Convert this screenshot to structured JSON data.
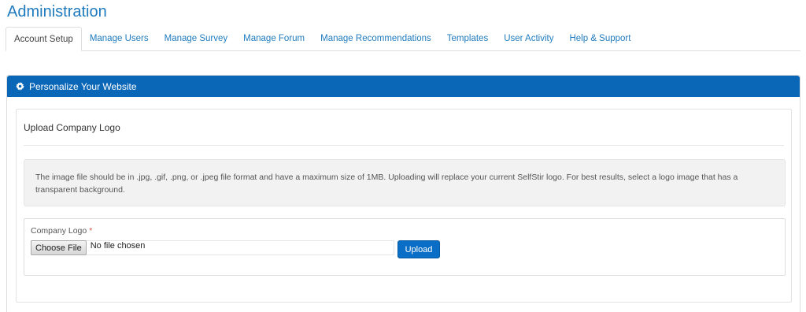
{
  "page": {
    "title": "Administration"
  },
  "tabs": [
    {
      "label": "Account Setup",
      "active": true
    },
    {
      "label": "Manage Users",
      "active": false
    },
    {
      "label": "Manage Survey",
      "active": false
    },
    {
      "label": "Manage Forum",
      "active": false
    },
    {
      "label": "Manage Recommendations",
      "active": false
    },
    {
      "label": "Templates",
      "active": false
    },
    {
      "label": "User Activity",
      "active": false
    },
    {
      "label": "Help & Support",
      "active": false
    }
  ],
  "panel": {
    "title": "Personalize Your Website",
    "icon": "gear-icon",
    "header_color": "#0a66b7"
  },
  "logo_section": {
    "title": "Upload Company Logo",
    "note": "The image file should be in .jpg, .gif, .png, or .jpeg file format and have a maximum size of 1MB. Uploading will replace your current SelfStir logo. For best results, select a logo image that has a transparent background.",
    "field_label": "Company Logo",
    "required_marker": "*",
    "choose_file_label": "Choose File",
    "file_status": "No file chosen",
    "upload_label": "Upload"
  },
  "colors": {
    "link": "#1f7bbd",
    "accent": "#0b6ec6",
    "required": "#d9534f"
  }
}
